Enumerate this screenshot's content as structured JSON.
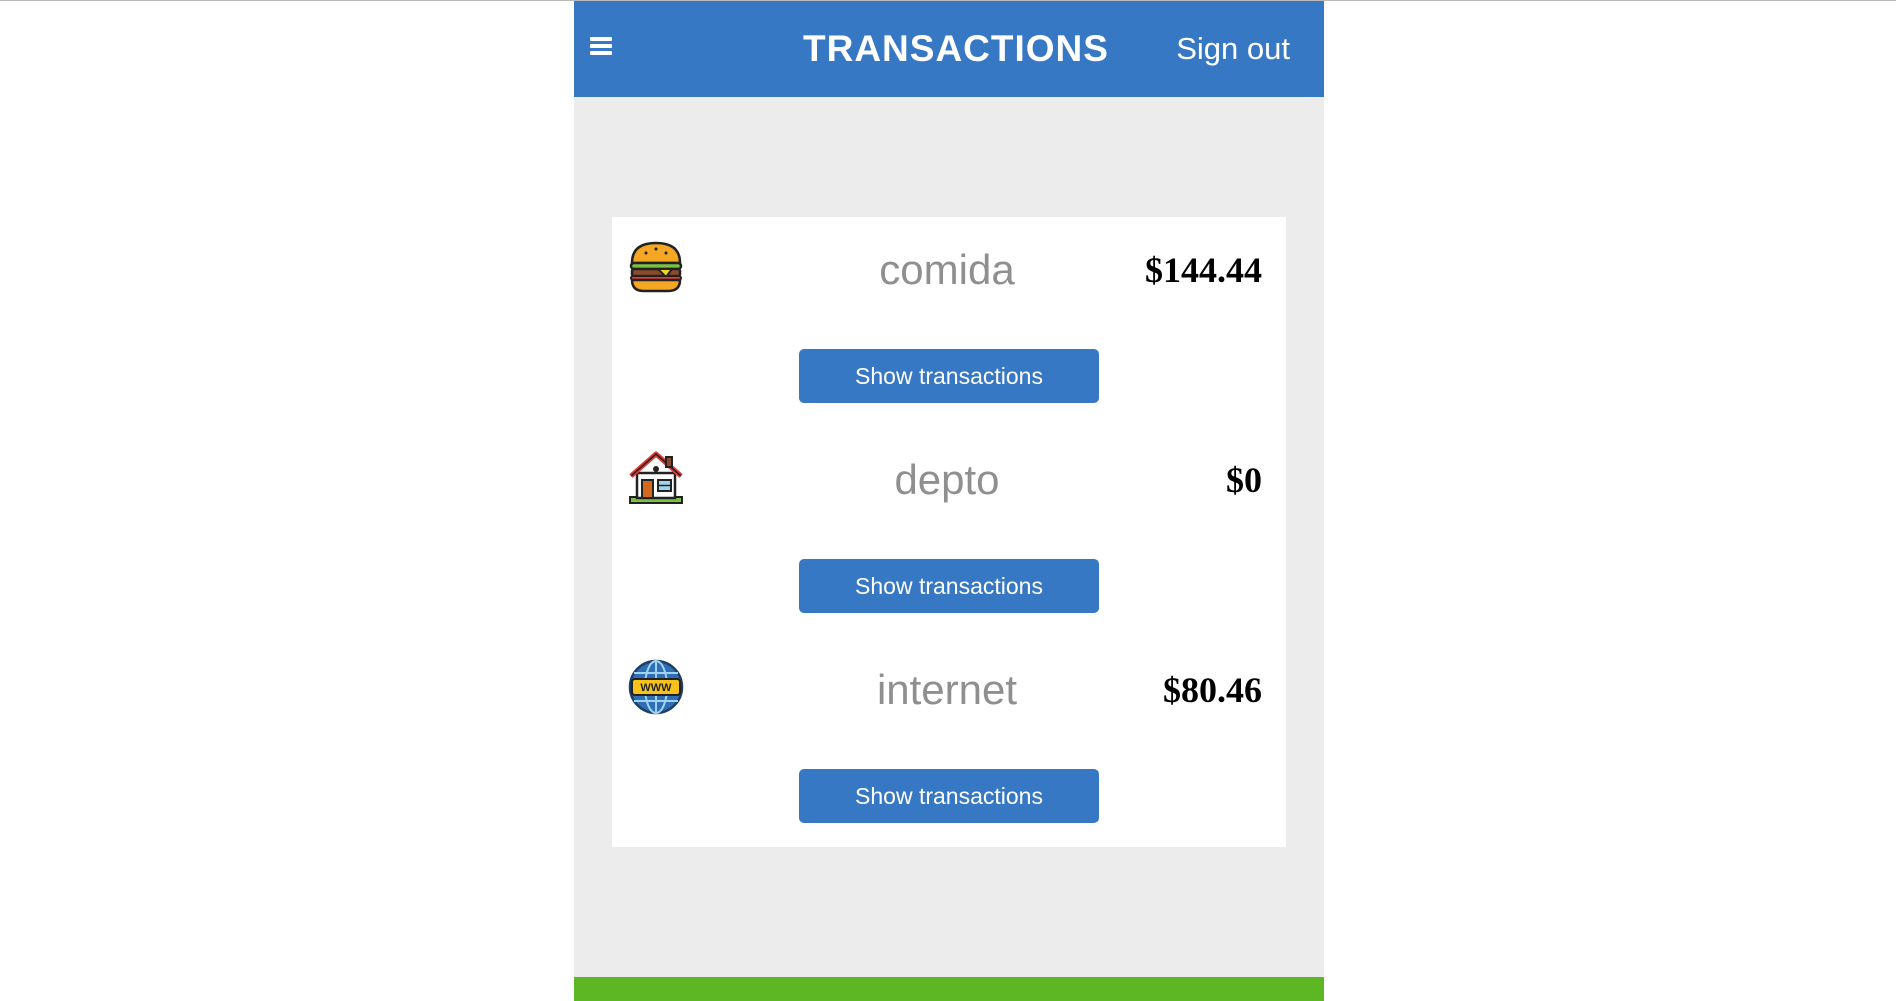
{
  "header": {
    "menu_icon": "hamburger-menu-icon",
    "title": "TRANSACTIONS",
    "sign_out": "Sign out"
  },
  "categories": [
    {
      "icon": "hamburger-food-icon",
      "name": "comida",
      "amount": "$144.44",
      "button": "Show transactions"
    },
    {
      "icon": "house-icon",
      "name": "depto",
      "amount": "$0",
      "button": "Show transactions"
    },
    {
      "icon": "globe-www-icon",
      "name": "internet",
      "amount": "$80.46",
      "button": "Show transactions"
    }
  ],
  "colors": {
    "primary": "#3778c4",
    "background": "#ececec",
    "footer": "#5db624",
    "category_text": "#8f8f8f"
  }
}
